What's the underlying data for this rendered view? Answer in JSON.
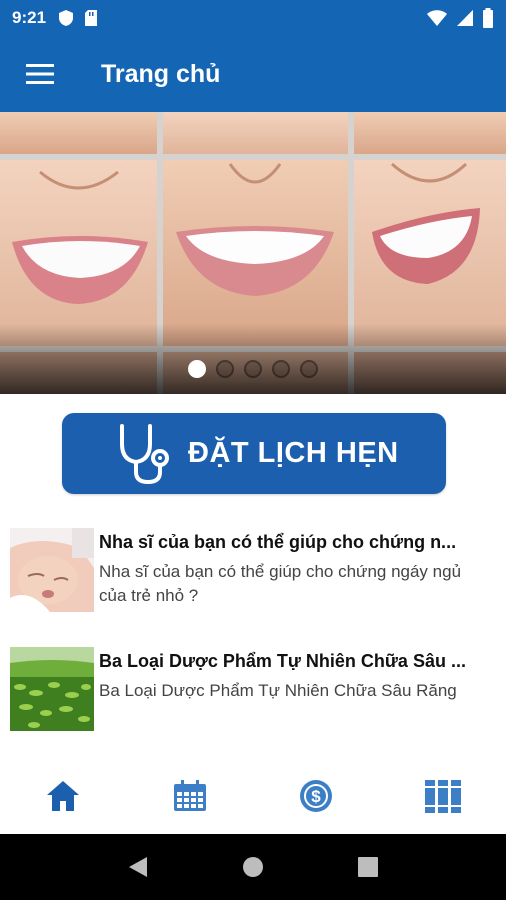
{
  "status_bar": {
    "time": "9:21",
    "left_icons": [
      "shield-icon",
      "sd-card-icon"
    ],
    "right_icons": [
      "wifi-icon",
      "signal-icon",
      "battery-icon"
    ]
  },
  "app_bar": {
    "title": "Trang chủ",
    "menu_icon": "menu-icon"
  },
  "carousel": {
    "pages": 5,
    "active_index": 0
  },
  "booking": {
    "label": "ĐẶT LỊCH HẸN",
    "icon": "stethoscope-icon"
  },
  "news": [
    {
      "title": "Nha sĩ của bạn có thể giúp cho chứng n...",
      "description": "Nha sĩ của bạn có thể giúp cho chứng ngáy ngủ của trẻ nhỏ ?"
    },
    {
      "title": "Ba Loại Dược Phẩm Tự Nhiên Chữa Sâu ...",
      "description": "Ba Loại Dược Phẩm Tự Nhiên Chữa Sâu Răng"
    }
  ],
  "bottom_nav": [
    "home-icon",
    "calendar-icon",
    "dollar-icon",
    "books-icon"
  ],
  "colors": {
    "primary": "#1565b5",
    "button": "#1c5fae"
  }
}
